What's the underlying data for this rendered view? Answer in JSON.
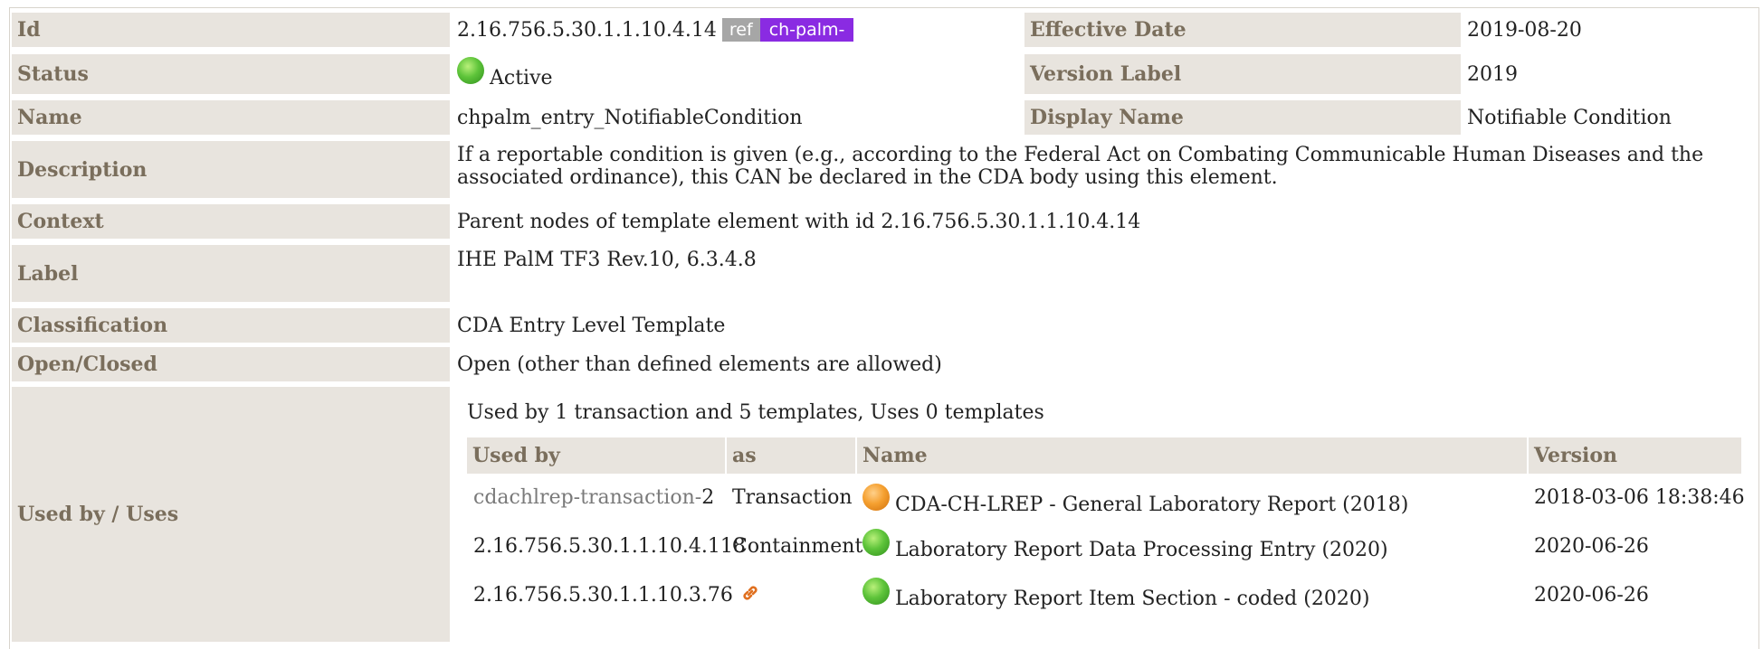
{
  "rows": {
    "id": {
      "label": "Id",
      "value": "2.16.756.5.30.1.1.10.4.14",
      "ref_badge": "ref",
      "id_badge": "ch-palm-"
    },
    "effective_date": {
      "label": "Effective Date",
      "value": "2019-08-20"
    },
    "status": {
      "label": "Status",
      "value": "Active",
      "icon": "green-status-dot"
    },
    "version_label": {
      "label": "Version Label",
      "value": "2019"
    },
    "name": {
      "label": "Name",
      "value": "chpalm_entry_NotifiableCondition"
    },
    "display_name": {
      "label": "Display Name",
      "value": "Notifiable Condition"
    },
    "description": {
      "label": "Description",
      "value": "If a reportable condition is given (e.g., according to the Federal Act on Combating Communicable Human Diseases and the associated ordinance), this CAN be declared in the CDA body using this element."
    },
    "context": {
      "label": "Context",
      "value": "Parent nodes of template element with id 2.16.756.5.30.1.1.10.4.14"
    },
    "label": {
      "label": "Label",
      "value": "IHE PalM TF3 Rev.10, 6.3.4.8"
    },
    "classification": {
      "label": "Classification",
      "value": "CDA Entry Level Template"
    },
    "open_closed": {
      "label": "Open/Closed",
      "value": "Open (other than defined elements are allowed)"
    },
    "used_by_uses": {
      "label": "Used by / Uses"
    }
  },
  "usage": {
    "summary": "Used by 1 transaction and 5 templates, Uses 0 templates",
    "headers": [
      "Used by",
      "as",
      "Name",
      "Version"
    ],
    "rows": [
      {
        "used_by_prefix": "cdachlrep-transaction-",
        "used_by_suffix": "2",
        "as": "Transaction",
        "icon": "orange-status-dot",
        "name": "CDA-CH-LREP - General Laboratory Report (2018)",
        "version": "2018-03-06 18:38:46"
      },
      {
        "used_by": "2.16.756.5.30.1.1.10.4.118",
        "as": "Containment",
        "icon": "green-status-dot",
        "name": "Laboratory Report Data Processing Entry (2020)",
        "version": "2020-06-26"
      },
      {
        "used_by": "2.16.756.5.30.1.1.10.3.76",
        "as_icon": "link-icon",
        "icon": "green-status-dot",
        "name": "Laboratory Report Item Section - coded (2020)",
        "version": "2020-06-26"
      }
    ]
  },
  "colors": {
    "label_bg": "#e8e4de",
    "label_text": "#7a6e5c",
    "badge_purple": "#8a2be2",
    "badge_gray": "#a6a6a6"
  }
}
